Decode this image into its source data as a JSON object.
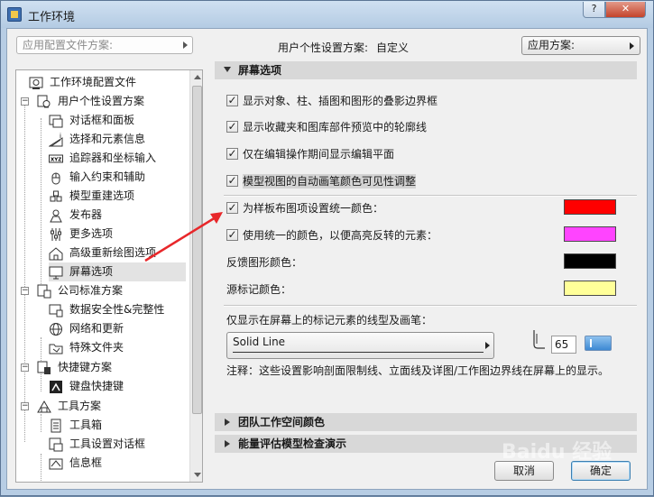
{
  "window": {
    "title": "工作环境",
    "help_label": "?",
    "close_label": "✕"
  },
  "header": {
    "profile_combo": "应用配置文件方案:",
    "scheme_label": "用户个性设置方案:",
    "scheme_value": "自定义",
    "apply_combo": "应用方案:"
  },
  "tree": {
    "items": [
      {
        "label": "工作环境配置文件",
        "icon": "profile-icon"
      },
      {
        "label": "用户个性设置方案",
        "icon": "user-scheme-icon"
      },
      {
        "label": "对话框和面板",
        "icon": "dialog-icon"
      },
      {
        "label": "选择和元素信息",
        "icon": "selection-icon"
      },
      {
        "label": "追踪器和坐标输入",
        "icon": "tracker-icon"
      },
      {
        "label": "输入约束和辅助",
        "icon": "mouse-icon"
      },
      {
        "label": "模型重建选项",
        "icon": "rebuild-icon"
      },
      {
        "label": "发布器",
        "icon": "publisher-icon"
      },
      {
        "label": "更多选项",
        "icon": "sliders-icon"
      },
      {
        "label": "高级重新绘图选项",
        "icon": "house-icon"
      },
      {
        "label": "屏幕选项",
        "icon": "monitor-icon"
      },
      {
        "label": "公司标准方案",
        "icon": "company-icon"
      },
      {
        "label": "数据安全性&完整性",
        "icon": "data-safety-icon"
      },
      {
        "label": "网络和更新",
        "icon": "globe-icon"
      },
      {
        "label": "特殊文件夹",
        "icon": "folder-icon"
      },
      {
        "label": "快捷键方案",
        "icon": "shortcut-scheme-icon"
      },
      {
        "label": "键盘快捷键",
        "icon": "keyboard-icon"
      },
      {
        "label": "工具方案",
        "icon": "tool-scheme-icon"
      },
      {
        "label": "工具箱",
        "icon": "toolbox-icon"
      },
      {
        "label": "工具设置对话框",
        "icon": "tool-dialog-icon"
      },
      {
        "label": "信息框",
        "icon": "infobox-icon"
      }
    ],
    "selected_index": 10
  },
  "screen_options": {
    "section_title": "屏幕选项",
    "options": [
      {
        "label": "显示对象、柱、插图和图形的叠影边界框",
        "checked": true
      },
      {
        "label": "显示收藏夹和图库部件预览中的轮廓线",
        "checked": true
      },
      {
        "label": "仅在编辑操作期间显示编辑平面",
        "checked": true
      },
      {
        "label": "模型视图的自动画笔颜色可见性调整",
        "checked": true
      },
      {
        "label": "为样板布图项设置统一颜色：",
        "checked": true,
        "color": "#ff0000"
      },
      {
        "label": "使用统一的颜色，以便高亮反转的元素：",
        "checked": true,
        "color": "#ff44ff"
      }
    ],
    "feedback_label": "反馈图形颜色：",
    "feedback_color": "#000000",
    "origin_label": "源标记颜色：",
    "origin_color": "#ffff99",
    "line_label": "仅显示在屏幕上的标记元素的线型及画笔：",
    "line_type": "Solid Line",
    "pen_number": "65",
    "note": "注释：这些设置影响剖面限制线、立面线及详图/工作图边界线在屏幕上的显示。"
  },
  "collapsed_sections": [
    "团队工作空间颜色",
    "能量评估模型检查演示"
  ],
  "buttons": {
    "cancel": "取消",
    "ok": "确定"
  },
  "watermark": "Baidu 经验",
  "colors": {
    "annotation_arrow": "#e8272a"
  }
}
